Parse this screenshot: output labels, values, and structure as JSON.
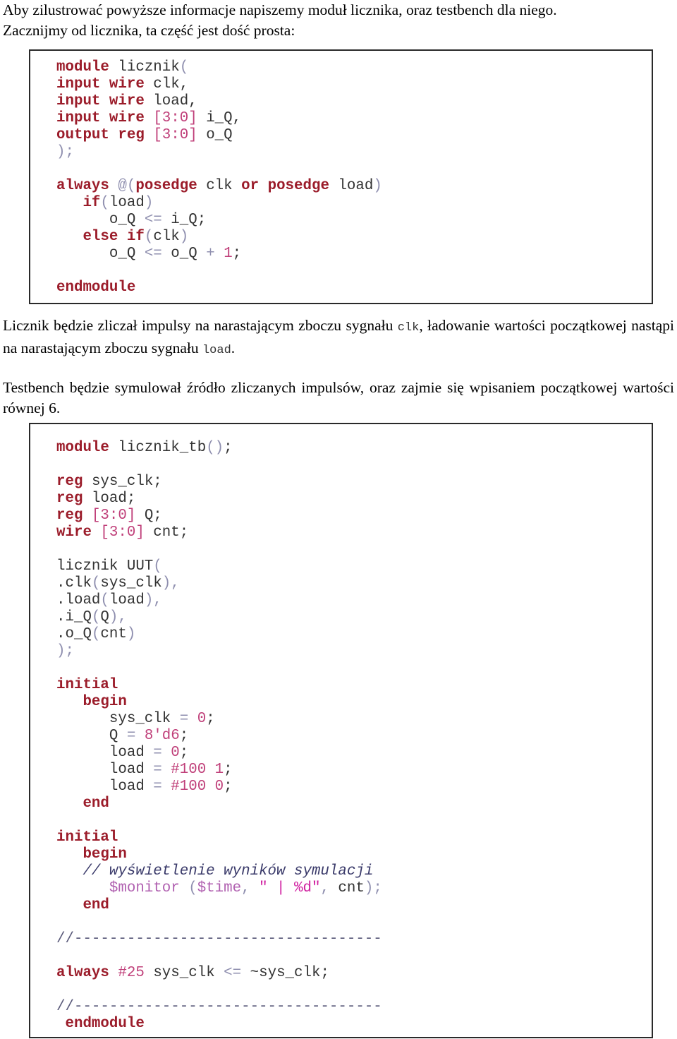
{
  "intro": {
    "line1": "Aby zilustrować powyższe informacje napiszemy moduł licznika, oraz testbench dla niego.",
    "line2": "Zacznijmy od licznika, ta część jest dość prosta:"
  },
  "module_code": {
    "kw_module": "module",
    "name": "licznik",
    "open": "(",
    "kw_input": "input",
    "kw_wire": "wire",
    "kw_output": "output",
    "kw_reg": "reg",
    "clk": "clk,",
    "load": "load,",
    "range": "[3:0]",
    "i_Q": "i_Q,",
    "o_Q": "o_Q",
    "close": ");",
    "kw_always": "always",
    "at": "@(",
    "kw_posedge": "posedge",
    "clk_plain": "clk",
    "kw_or": "or",
    "load_plain": "load",
    "paren_close": ")",
    "kw_if": "if",
    "if_cond_open": "(",
    "if_cond": "load",
    "if_cond_close": ")",
    "assign1_lhs": "o_Q",
    "assign_op": "<=",
    "assign1_rhs": "i_Q;",
    "kw_else": "else",
    "else_cond": "clk",
    "assign2_rhs": "o_Q",
    "plus": "+",
    "one": "1",
    "semi": ";",
    "kw_endmodule": "endmodule"
  },
  "description": {
    "para1_part1": "Licznik będzie zliczał impulsy na narastającym zboczu sygnału ",
    "para1_code1": "clk",
    "para1_part2": ", ładowanie wartości początkowej nastąpi na narastającym zboczu sygnału ",
    "para1_code2": "load",
    "para1_part3": ".",
    "para2": "Testbench będzie symulował źródło zliczanych impulsów, oraz zajmie się wpisaniem początkowej wartości równej 6."
  },
  "tb_code": {
    "kw_module": "module",
    "name": "licznik_tb",
    "parens": "()",
    "semi": ";",
    "kw_reg": "reg",
    "kw_wire": "wire",
    "range": "[3:0]",
    "sys_clk_decl": "sys_clk;",
    "load_decl": "load;",
    "Q_decl": "Q;",
    "cnt_decl": "cnt;",
    "inst": "licznik UUT",
    "open": "(",
    "port_clk": ".clk",
    "port_clk_sig": "sys_clk",
    "port_load": ".load",
    "port_load_sig": "load",
    "port_iQ": ".i_Q",
    "port_iQ_sig": "Q",
    "port_oQ": ".o_Q",
    "port_oQ_sig": "cnt",
    "comma": ",",
    "rparen": ")",
    "close": ");",
    "kw_initial": "initial",
    "kw_begin": "begin",
    "kw_end": "end",
    "s1_lhs": "sys_clk",
    "eq": "=",
    "s1_val": "0",
    "s2_lhs": "Q",
    "s2_val": "8'd6",
    "s3_lhs": "load",
    "s3_val": "0",
    "s4_lhs": "load",
    "s4_delay": "#100",
    "s4_val": "1",
    "s5_lhs": "load",
    "s5_delay": "#100",
    "s5_val": "0",
    "comment": "// wyświetlenie wyników symulacji",
    "monitor": "$monitor",
    "monitor_open": " (",
    "time": "$time",
    "monitor_comma": ", ",
    "fmt": "\" | %d\"",
    "monitor_tail_comma": ", ",
    "monitor_arg": "cnt",
    "monitor_close": ");",
    "separator": "//-----------------------------------",
    "kw_always": "always",
    "delay25": "#25",
    "clk_stmt": "sys_clk",
    "nb_op": "<=",
    "clk_rhs": "~sys_clk;",
    "kw_endmodule": "endmodule"
  }
}
